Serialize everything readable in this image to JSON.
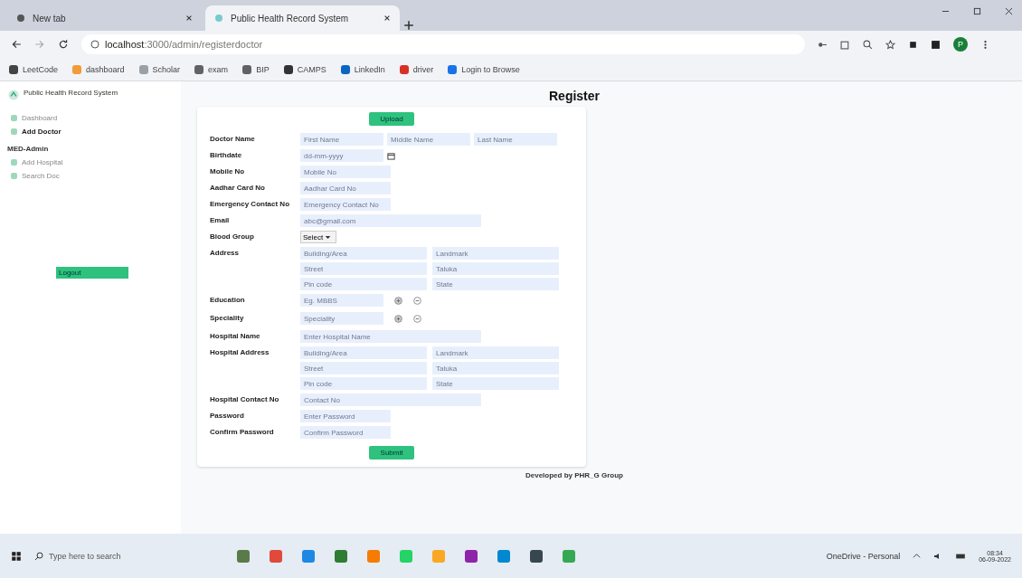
{
  "browser": {
    "tabs": [
      {
        "title": "New tab",
        "selected": false
      },
      {
        "title": "Public Health Record System",
        "selected": true
      }
    ],
    "url_host": "localhost",
    "url_path": ":3000/admin/registerdoctor",
    "profile_initial": "P",
    "bookmarks": [
      {
        "label": "LeetCode",
        "color": "#444444"
      },
      {
        "label": "dashboard",
        "color": "#f29b38"
      },
      {
        "label": "Scholar",
        "color": "#9aa0a6"
      },
      {
        "label": "exam",
        "color": "#5f6368"
      },
      {
        "label": "BIP",
        "color": "#5f6368"
      },
      {
        "label": "CAMPS",
        "color": "#333333"
      },
      {
        "label": "LinkedIn",
        "color": "#0a66c2"
      },
      {
        "label": "driver",
        "color": "#d93025"
      },
      {
        "label": "Login to Browse",
        "color": "#1a73e8"
      }
    ]
  },
  "sidebar": {
    "title": "Public Health Record System",
    "items": [
      {
        "label": "Dashboard",
        "selected": false
      },
      {
        "label": "Add Doctor",
        "selected": true
      }
    ],
    "section": "MED-Admin",
    "section_items": [
      {
        "label": "Add Hospital",
        "selected": false
      },
      {
        "label": "Search Doc",
        "selected": false
      }
    ],
    "logout": "Logout"
  },
  "page_title": "Register",
  "form": {
    "upload": "Upload",
    "submit": "Submit",
    "fields": [
      {
        "kind": "triple",
        "label": "Doctor Name",
        "placeholders": [
          "First Name",
          "Middle Name",
          "Last Name"
        ]
      },
      {
        "kind": "date",
        "label": "Birthdate",
        "placeholders": [
          "dd-mm-yyyy"
        ]
      },
      {
        "kind": "short",
        "label": "Mobile No",
        "placeholders": [
          "Mobile No"
        ]
      },
      {
        "kind": "short",
        "label": "Aadhar Card No",
        "placeholders": [
          "Aadhar Card No"
        ]
      },
      {
        "kind": "short",
        "label": "Emergency Contact No",
        "placeholders": [
          "Emergency Contact No"
        ]
      },
      {
        "kind": "wide",
        "label": "Email",
        "placeholders": [
          "abc@gmail.com"
        ]
      },
      {
        "kind": "select",
        "label": "Blood Group",
        "value": "Select"
      },
      {
        "kind": "grid",
        "label": "Address",
        "placeholders": [
          "Building/Area",
          "Landmark",
          "Street",
          "Taluka",
          "Pin code",
          "State"
        ]
      },
      {
        "kind": "multi",
        "label": "Education",
        "placeholders": [
          "Eg. MBBS"
        ]
      },
      {
        "kind": "multi",
        "label": "Speciality",
        "placeholders": [
          "Speciality"
        ]
      },
      {
        "kind": "wide",
        "label": "Hospital Name",
        "placeholders": [
          "Enter Hospital Name"
        ]
      },
      {
        "kind": "grid",
        "label": "Hospital Address",
        "placeholders": [
          "Building/Area",
          "Landmark",
          "Street",
          "Taluka",
          "Pin code",
          "State"
        ]
      },
      {
        "kind": "wide",
        "label": "Hospital Contact No",
        "placeholders": [
          "Contact No"
        ]
      },
      {
        "kind": "short",
        "label": "Password",
        "placeholders": [
          "Enter Password"
        ]
      },
      {
        "kind": "short",
        "label": "Confirm Password",
        "placeholders": [
          "Confirm Password"
        ]
      }
    ]
  },
  "footer": "Developed by PHR_G Group",
  "taskbar": {
    "search": "Type here to search",
    "tray": "OneDrive - Personal",
    "time": "08:34",
    "date": "06-09-2022"
  }
}
